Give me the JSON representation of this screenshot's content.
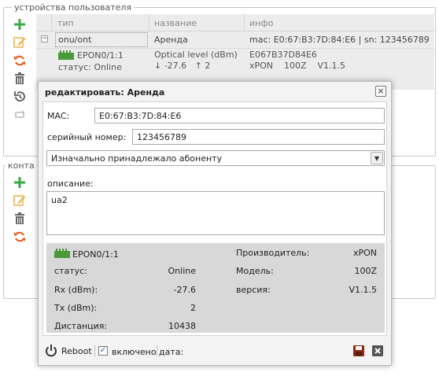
{
  "devices_section": {
    "legend": "устройства пользователя",
    "columns": {
      "type": "тип",
      "name": "название",
      "info": "инфо"
    },
    "row": {
      "type": "onu/ont",
      "name": "Аренда",
      "info": "mac: E0:67:B3:7D:84:E6 | sn: 123456789",
      "port": "EPON0/1:1",
      "status": "статус: Online",
      "optical_label": "Optical level (dBm)",
      "optical_values": "↓ -27.6   ↑ 2",
      "sn_value": "E067B37D84E6",
      "vendor_model_version": "xPON    100Z    V1.1.5"
    }
  },
  "contacts_section": {
    "legend": "конта"
  },
  "dialog": {
    "title": "редактировать: Аренда",
    "close_icon": "×",
    "mac_label": "MAC:",
    "mac_value": "E0:67:B3:7D:84:E6",
    "serial_label": "серийный номер:",
    "serial_value": "123456789",
    "ownership_selected": "Изначально принадлежало абоненту",
    "description_label": "описание:",
    "description_value": "ua2",
    "info": {
      "port": "EPON0/1:1",
      "status_label": "статус:",
      "status_value": "Online",
      "rx_label": "Rx (dBm):",
      "rx_value": "-27.6",
      "tx_label": "Tx (dBm):",
      "tx_value": "2",
      "distance_label": "Дистанция:",
      "distance_value": "10438",
      "vendor_label": "Производитель:",
      "vendor_value": "xPON",
      "model_label": "Модель:",
      "model_value": "100Z",
      "version_label": "версия:",
      "version_value": "V1.1.5"
    },
    "footer": {
      "reboot_label": "Reboot",
      "enabled_label": "включено",
      "enabled_checked": true,
      "date_label": "дата:"
    }
  },
  "colors": {
    "add": "#3aa845",
    "edit": "#e8b04b",
    "refresh": "#e4622a",
    "port_green": "#4a9a3a"
  }
}
